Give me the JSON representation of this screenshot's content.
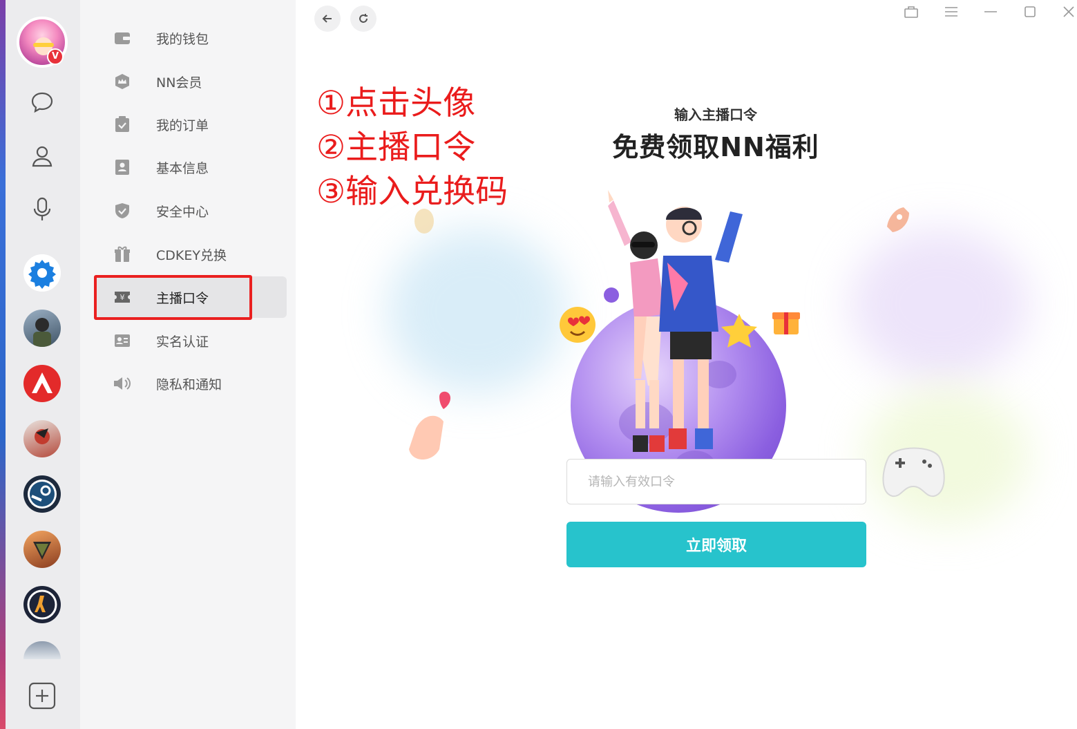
{
  "user": {
    "badge": "V"
  },
  "menu": {
    "items": [
      {
        "label": "我的钱包",
        "icon": "wallet-icon"
      },
      {
        "label": "NN会员",
        "icon": "crown-icon"
      },
      {
        "label": "我的订单",
        "icon": "order-icon"
      },
      {
        "label": "基本信息",
        "icon": "profile-card-icon"
      },
      {
        "label": "安全中心",
        "icon": "shield-icon"
      },
      {
        "label": "CDKEY兑换",
        "icon": "gift-icon"
      },
      {
        "label": "主播口令",
        "icon": "ticket-icon",
        "active": true
      },
      {
        "label": "实名认证",
        "icon": "id-card-icon"
      },
      {
        "label": "隐私和通知",
        "icon": "speaker-icon"
      }
    ]
  },
  "annotations": [
    "①点击头像",
    "②主播口令",
    "③输入兑换码"
  ],
  "content": {
    "subtitle": "输入主播口令",
    "title": "免费领取NN福利",
    "input_placeholder": "请输入有效口令",
    "input_value": "",
    "submit_label": "立即领取"
  },
  "colors": {
    "accent": "#27c3cc",
    "annotation": "#ea1c1c",
    "badge": "#e8313a"
  }
}
